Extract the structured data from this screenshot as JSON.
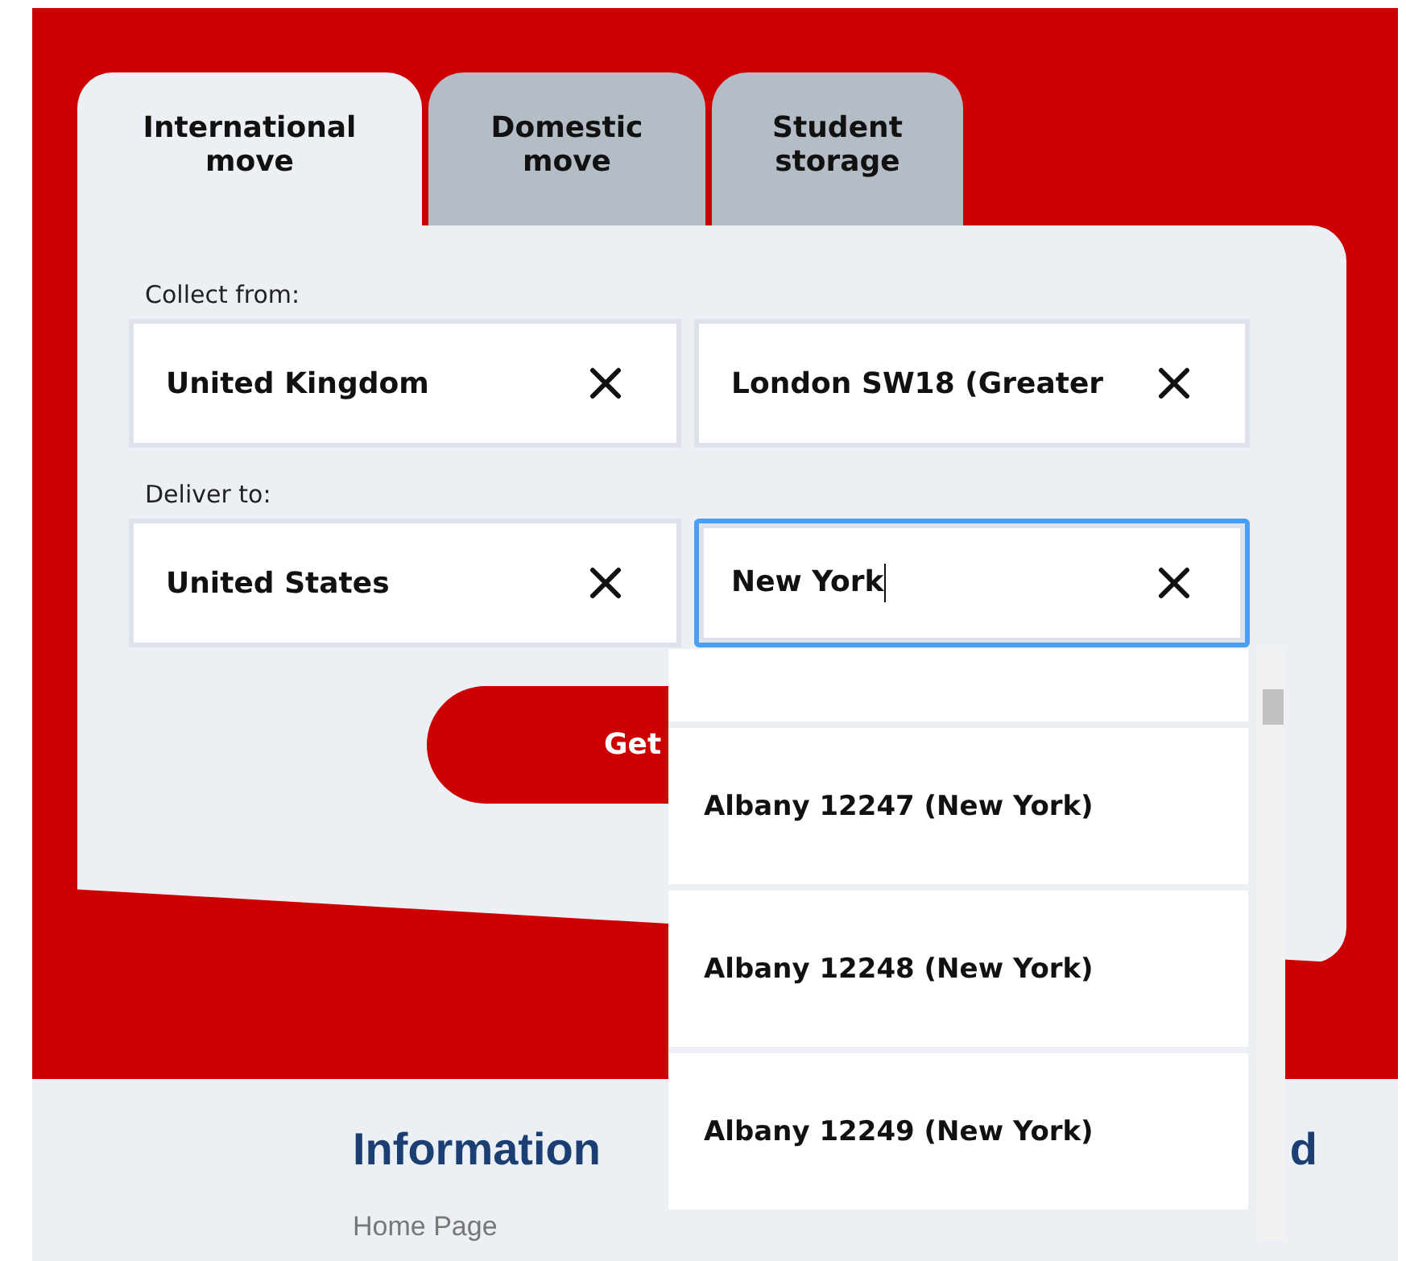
{
  "tabs": [
    {
      "label": "International move",
      "selected": true
    },
    {
      "label": "Domestic move",
      "selected": false
    },
    {
      "label": "Student storage",
      "selected": false
    }
  ],
  "sections": [
    {
      "label": "Collect from:",
      "fields": [
        {
          "value": "United Kingdom",
          "focused": false
        },
        {
          "value": "London SW18 (Greater",
          "focused": false
        }
      ]
    },
    {
      "label": "Deliver to:",
      "fields": [
        {
          "value": "United States",
          "focused": false
        },
        {
          "value": "New York",
          "focused": true
        }
      ]
    }
  ],
  "submit_button": "Get",
  "suggestions": [
    "Albany 12247 (New York)",
    "Albany 12248 (New York)",
    "Albany 12249 (New York)"
  ],
  "footer": {
    "columns": [
      {
        "heading": "Information",
        "links": [
          "Home Page"
        ]
      },
      {
        "heading": "d"
      }
    ]
  }
}
